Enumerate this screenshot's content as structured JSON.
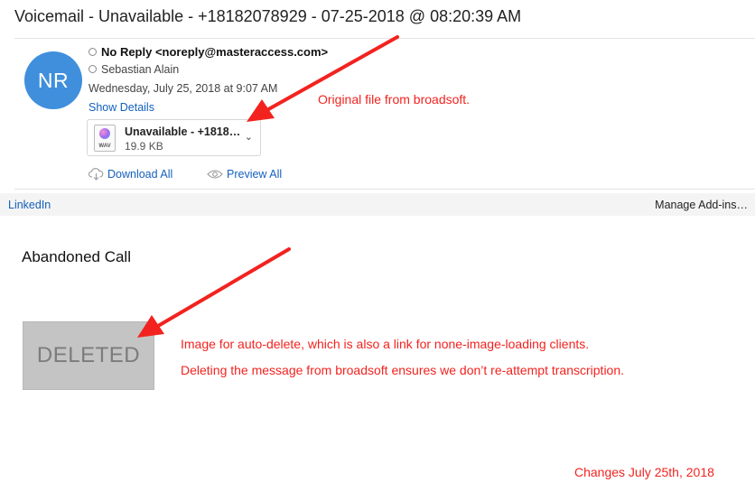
{
  "email": {
    "subject": "Voicemail - Unavailable - +18182078929 - 07-25-2018 @ 08:20:39 AM",
    "avatar_initials": "NR",
    "avatar_color": "#3f8fdc",
    "from": "No Reply <noreply@masteraccess.com>",
    "to": "Sebastian Alain",
    "date": "Wednesday, July 25, 2018 at 9:07 AM",
    "show_details": "Show Details",
    "attachment": {
      "name": "Unavailable - +1818…",
      "size": "19.9 KB",
      "icon_ext": "WAV",
      "icon": "audio-file-icon"
    },
    "download_all": "Download All",
    "preview_all": "Preview All"
  },
  "addin_bar": {
    "linkedin": "LinkedIn",
    "manage": "Manage Add-ins…"
  },
  "message_body": {
    "title": "Abandoned Call",
    "deleted_image_text": "DELETED"
  },
  "annotations": {
    "color": "#f2231f",
    "original_file": "Original file from broadsoft.",
    "auto_delete": "Image for auto-delete, which is also a link for none-image-loading clients.",
    "deleting_note": "Deleting the message from broadsoft ensures we don’t re-attempt transcription.",
    "changes": "Changes July 25th, 2018"
  },
  "colors": {
    "link": "#1560bd",
    "addin_bar_bg": "#f4f4f4",
    "deleted_bg": "#c4c4c4"
  }
}
